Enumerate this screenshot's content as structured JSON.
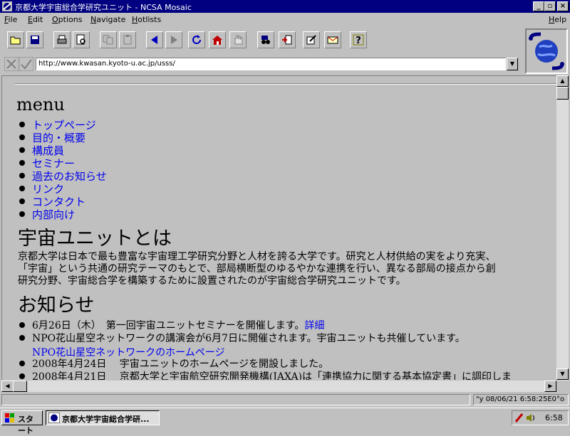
{
  "window": {
    "title": "京都大学宇宙総合学研究ユニット - NCSA Mosaic",
    "controls": {
      "minimize": "_",
      "maximize": "▫",
      "close": "×"
    }
  },
  "menubar": {
    "items": [
      {
        "accel": "F",
        "rest": "ile"
      },
      {
        "accel": "E",
        "rest": "dit"
      },
      {
        "accel": "O",
        "rest": "ptions"
      },
      {
        "accel": "N",
        "rest": "avigate"
      },
      {
        "accel": "H",
        "rest": "otlists"
      },
      {
        "accel": "H",
        "rest": "elp"
      }
    ]
  },
  "toolbar": {
    "icons": [
      "open-folder-icon",
      "save-icon",
      "print-icon",
      "print-preview-icon",
      "copy-icon",
      "paste-icon",
      "back-icon",
      "forward-icon",
      "reload-icon",
      "home-icon",
      "stop-hand-icon",
      "find-icon",
      "add-hotlist-icon",
      "annotate-icon",
      "mail-icon",
      "help-icon"
    ]
  },
  "address": {
    "url": "http://www.kwasan.kyoto-u.ac.jp/usss/"
  },
  "page": {
    "menu_heading": "menu",
    "menu_items": [
      "トップページ",
      "目的・概要",
      "構成員",
      "セミナー",
      "過去のお知らせ",
      "リンク",
      "コンタクト",
      "内部向け"
    ],
    "about_heading": "宇宙ユニットとは",
    "about_lines": [
      "京都大学は日本で最も豊富な宇宙理工学研究分野と人材を誇る大学です。研究と人材供給の実をより充実、",
      "「宇宙」という共通の研究テーマのもとで、部局横断型のゆるやかな連携を行い、異なる部局の接点から創",
      "研究分野、宇宙総合学を構築するために設置されたのが宇宙総合学研究ユニットです。"
    ],
    "news_heading": "お知らせ",
    "news": [
      {
        "text": "6月26日（木）　第一回宇宙ユニットセミナーを開催します。",
        "link": "詳細"
      },
      {
        "text": "NPO花山星空ネットワークの講演会が6月7日に開催されます。宇宙ユニットも共催しています。",
        "link": "NPO花山星空ネットワークのホームページ"
      },
      {
        "text": "2008年4月24日　 宇宙ユニットのホームページを開設しました。",
        "link": ""
      },
      {
        "text": "2008年4月21日　 京都大学と宇宙航空研究開発機構(JAXA)は「連携協力に関する基本協定書」に調印しま",
        "link": ""
      }
    ]
  },
  "status": {
    "main": "",
    "datetime": "\"y 08/06/21 6:58:25E0°o"
  },
  "taskbar": {
    "start": "スタート",
    "task": "京都大学宇宙総合学研...",
    "clock": "6:58"
  },
  "colors": {
    "titlebar": "#000080",
    "link": "#0000ee",
    "face": "#c0c0c0"
  }
}
